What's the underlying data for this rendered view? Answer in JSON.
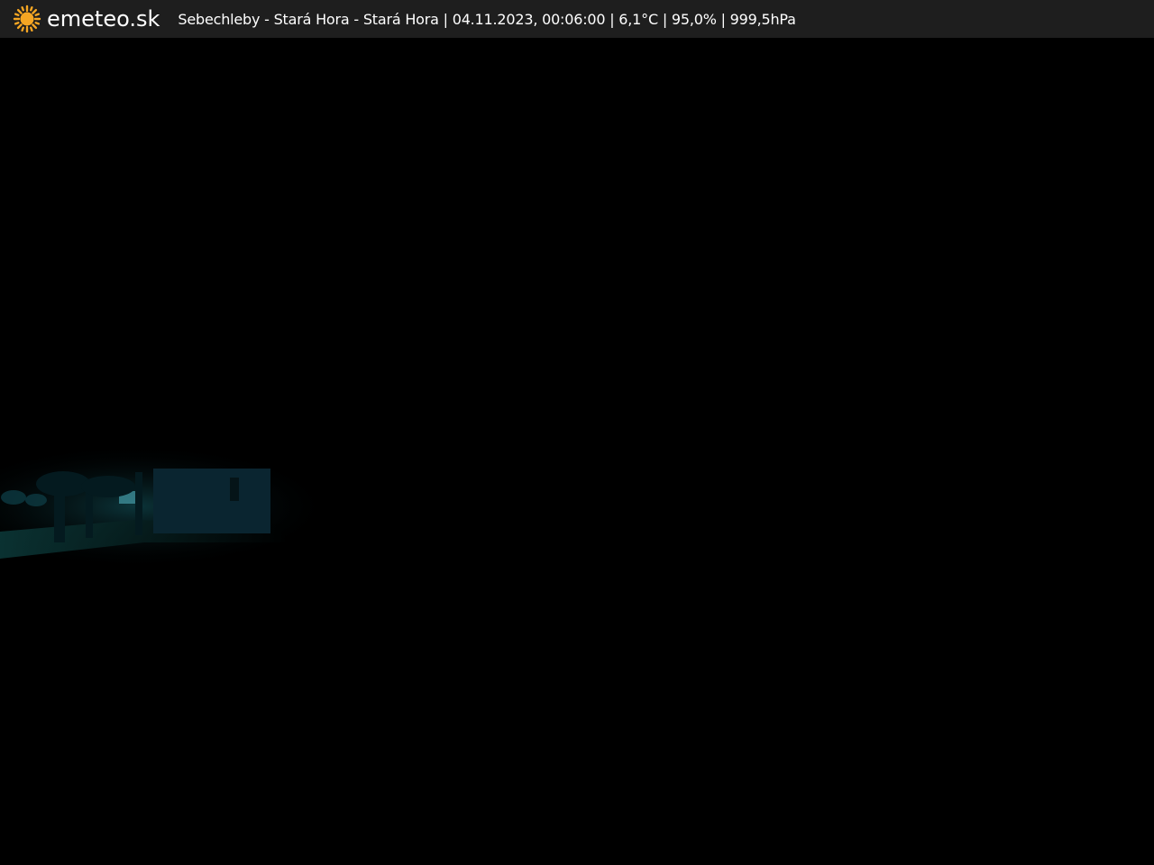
{
  "header": {
    "brand": "emeteo.sk",
    "logo_icon": "sun-icon",
    "caption": "Sebechleby - Stará Hora - Stará Hora | 04.11.2023, 00:06:00 | 6,1°C | 95,0% | 999,5hPa"
  },
  "colors": {
    "header_background": "#1e1e1e",
    "sun": "#f5a623",
    "text": "#ffffff",
    "scene_background": "#000000"
  }
}
